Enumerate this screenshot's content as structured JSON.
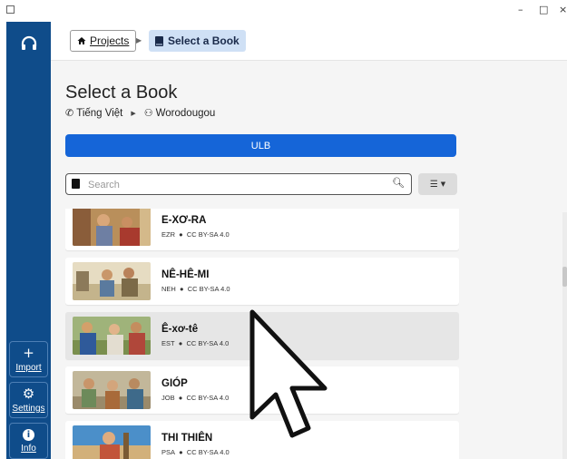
{
  "window": {
    "controls": {
      "minimize": "–",
      "maximize": "□",
      "close": "×"
    }
  },
  "sidebar": {
    "top_icon": "headphones-icon",
    "buttons": [
      {
        "label": "Import",
        "glyph": "+",
        "icon": "plus-icon"
      },
      {
        "label": "Settings",
        "glyph": "⚙",
        "icon": "gear-icon"
      },
      {
        "label": "Info",
        "glyph": "i",
        "icon": "info-icon"
      }
    ]
  },
  "breadcrumb": {
    "projects_label": "Projects",
    "current_label": "Select a Book"
  },
  "page": {
    "title": "Select a Book",
    "language": "Tiếng Việt",
    "project_language": "Worodougou",
    "resource_button": "ULB"
  },
  "search": {
    "placeholder": "Search",
    "value": ""
  },
  "books": [
    {
      "name": "E-XƠ-RA",
      "code": "EZR",
      "license": "CC BY-SA 4.0",
      "selected": false
    },
    {
      "name": "NÊ-HÊ-MI",
      "code": "NEH",
      "license": "CC BY-SA 4.0",
      "selected": false
    },
    {
      "name": "Ê-xơ-tê",
      "code": "EST",
      "license": "CC BY-SA 4.0",
      "selected": true
    },
    {
      "name": "GIÓP",
      "code": "JOB",
      "license": "CC BY-SA 4.0",
      "selected": false
    },
    {
      "name": "THI THIÊN",
      "code": "PSA",
      "license": "CC BY-SA 4.0",
      "selected": false
    }
  ],
  "colors": {
    "sidebar": "#0f4c8a",
    "accent": "#1565d8",
    "breadcrumb_current": "#cfe0f5"
  }
}
